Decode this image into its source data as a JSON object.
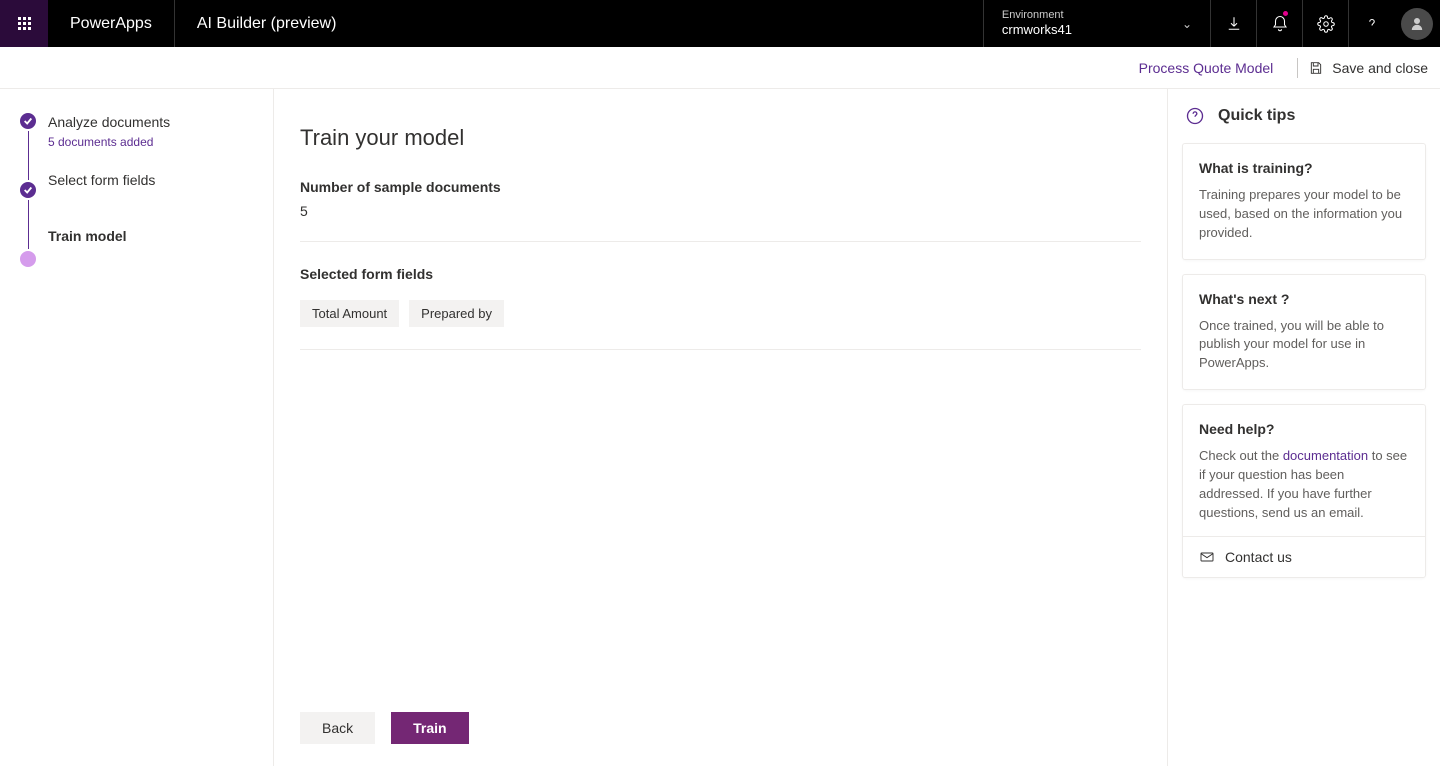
{
  "header": {
    "brand": "PowerApps",
    "page_title": "AI Builder (preview)",
    "environment_label": "Environment",
    "environment_name": "crmworks41"
  },
  "subheader": {
    "model_name": "Process Quote Model",
    "save_close": "Save and close"
  },
  "steps": {
    "items": [
      {
        "title": "Analyze documents",
        "subtitle": "5 documents added"
      },
      {
        "title": "Select form fields",
        "subtitle": ""
      },
      {
        "title": "Train model",
        "subtitle": ""
      }
    ]
  },
  "main": {
    "heading": "Train your model",
    "sample_label": "Number of sample documents",
    "sample_value": "5",
    "fields_label": "Selected form fields",
    "chips": [
      "Total Amount",
      "Prepared by"
    ]
  },
  "footer": {
    "back": "Back",
    "train": "Train"
  },
  "tips": {
    "title": "Quick tips",
    "cards": [
      {
        "heading": "What is training?",
        "body": "Training prepares your model to be used, based on the information you provided."
      },
      {
        "heading": "What's next ?",
        "body": "Once trained, you will be able to publish your model for use in PowerApps."
      },
      {
        "heading": "Need help?",
        "body_pre": "Check out the ",
        "link_text": "documentation",
        "body_post": " to see if your question has been addressed. If you have further questions, send us an email.",
        "contact": "Contact us"
      }
    ]
  }
}
